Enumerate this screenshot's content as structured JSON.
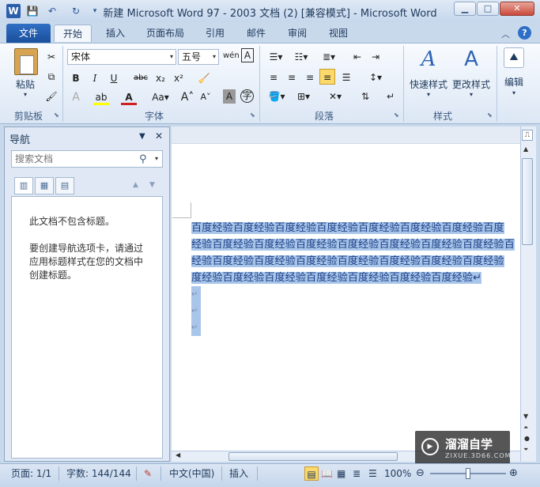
{
  "window": {
    "title": "新建 Microsoft Word 97 - 2003 文档 (2) [兼容模式] - Microsoft Word",
    "app_icon": "W"
  },
  "tabs": [
    "文件",
    "开始",
    "插入",
    "页面布局",
    "引用",
    "邮件",
    "审阅",
    "视图"
  ],
  "ribbon": {
    "clipboard": {
      "paste": "粘贴",
      "group": "剪贴板"
    },
    "font": {
      "family": "宋体",
      "size": "五号",
      "wen": "wén",
      "group": "字体"
    },
    "paragraph": {
      "group": "段落"
    },
    "styles": {
      "quick": "快速样式",
      "change": "更改样式",
      "group": "样式"
    },
    "edit": {
      "label": "编辑"
    }
  },
  "nav": {
    "title": "导航",
    "search_placeholder": "搜索文档",
    "msg1": "此文档不包含标题。",
    "msg2_l1": "要创建导航选项卡，请通过",
    "msg2_l2": "应用标题样式在您的文档中",
    "msg2_l3": "创建标题。"
  },
  "document": {
    "lines": [
      "百度经验百度经验百度经验百度经验百度经验百度经验百度经验百度",
      "经验百度经验百度经验百度经验百度经验百度经验百度经验百度经验百",
      "经验百度经验百度经验百度经验百度经验百度经验百度经验百度经验",
      "度经验百度经验百度经验百度经验百度经验百度经验百度经验↵"
    ],
    "para_mark": "↵"
  },
  "status": {
    "page": "页面: 1/1",
    "words": "字数: 144/144",
    "lang": "中文(中国)",
    "mode": "插入",
    "zoom": "100%"
  },
  "watermark": {
    "brand": "溜溜自学",
    "url": "ZIXUE.3D66.COM"
  }
}
